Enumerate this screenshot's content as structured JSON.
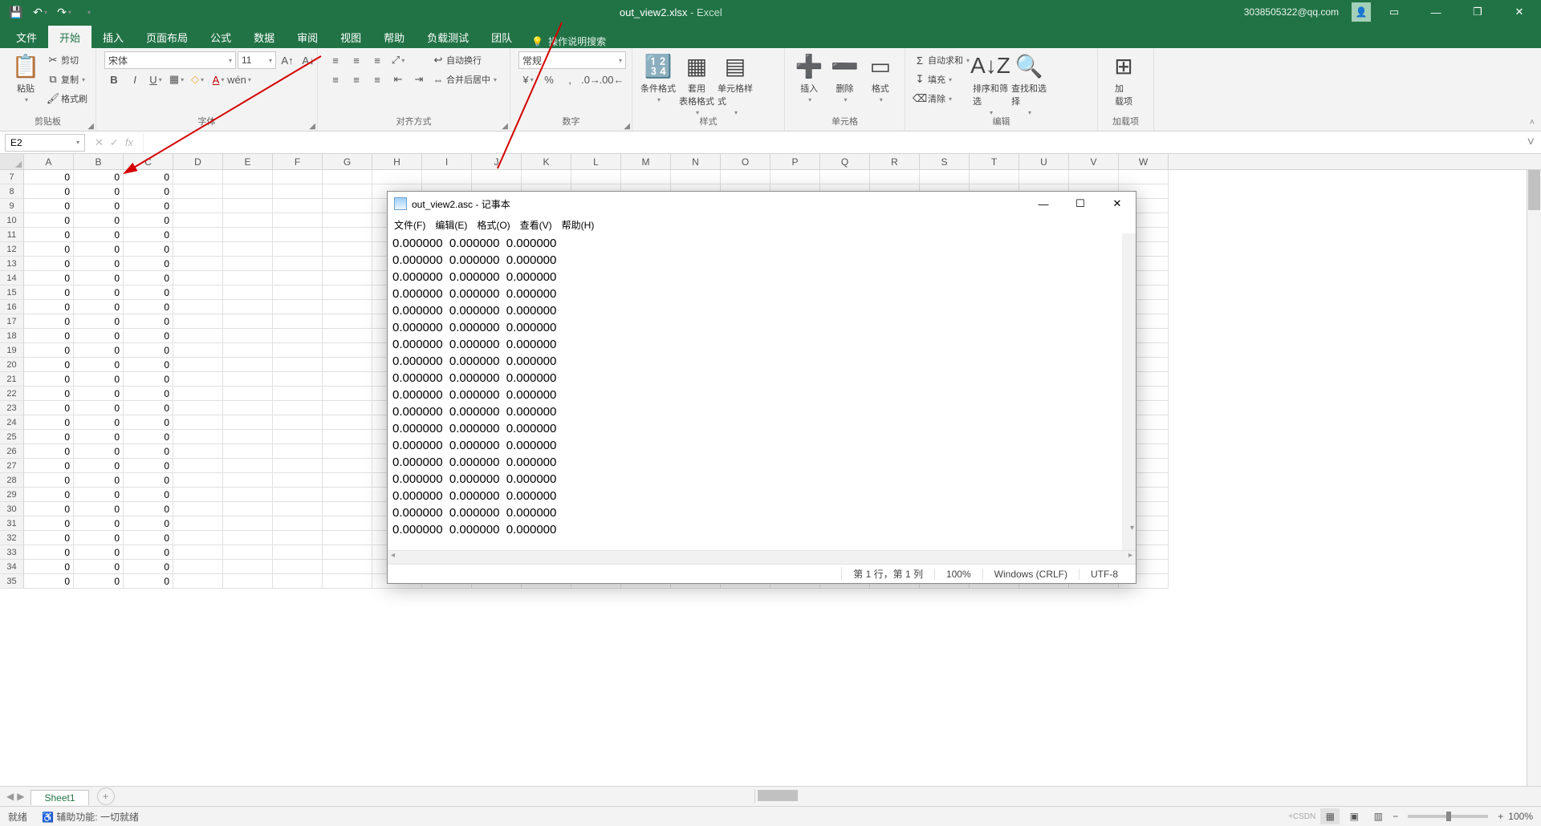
{
  "titlebar": {
    "filename": "out_view2.xlsx",
    "app": "Excel",
    "user": "3038505322@qq.com"
  },
  "tabs": [
    "文件",
    "开始",
    "插入",
    "页面布局",
    "公式",
    "数据",
    "审阅",
    "视图",
    "帮助",
    "负载测试",
    "团队"
  ],
  "active_tab": 1,
  "tell_me": "操作说明搜索",
  "ribbon": {
    "clipboard": {
      "paste": "粘贴",
      "cut": "剪切",
      "copy": "复制",
      "format_painter": "格式刷",
      "label": "剪贴板"
    },
    "font": {
      "name": "宋体",
      "size": "11",
      "label": "字体"
    },
    "alignment": {
      "wrap": "自动换行",
      "merge": "合并后居中",
      "label": "对齐方式"
    },
    "number": {
      "format": "常规",
      "label": "数字"
    },
    "styles": {
      "cond": "条件格式",
      "table": "套用\n表格格式",
      "cell": "单元格样式",
      "label": "样式"
    },
    "cells": {
      "insert": "插入",
      "delete": "删除",
      "format": "格式",
      "label": "单元格"
    },
    "editing": {
      "sum": "自动求和",
      "fill": "填充",
      "clear": "清除",
      "sort": "排序和筛选",
      "find": "查找和选择",
      "label": "编辑"
    },
    "addins": {
      "label": "加载项",
      "btn": "加\n载项"
    }
  },
  "namebox": "E2",
  "columns": [
    "A",
    "B",
    "C",
    "D",
    "E",
    "F",
    "G",
    "H",
    "I",
    "J",
    "K",
    "L",
    "M",
    "N",
    "O",
    "P",
    "Q",
    "R",
    "S",
    "T",
    "U",
    "V",
    "W"
  ],
  "first_row": 7,
  "row_count": 29,
  "data_cols": 3,
  "cell_value": "0",
  "sheet": "Sheet1",
  "statusbar": {
    "ready": "就绪",
    "access": "辅助功能: 一切就绪",
    "zoom": "100%"
  },
  "notepad": {
    "title": "out_view2.asc - 记事本",
    "menu": [
      "文件(F)",
      "编辑(E)",
      "格式(O)",
      "查看(V)",
      "帮助(H)"
    ],
    "line": "0.000000  0.000000  0.000000",
    "lines": 18,
    "status": {
      "pos": "第 1 行，第 1 列",
      "zoom": "100%",
      "eol": "Windows (CRLF)",
      "enc": "UTF-8"
    }
  }
}
